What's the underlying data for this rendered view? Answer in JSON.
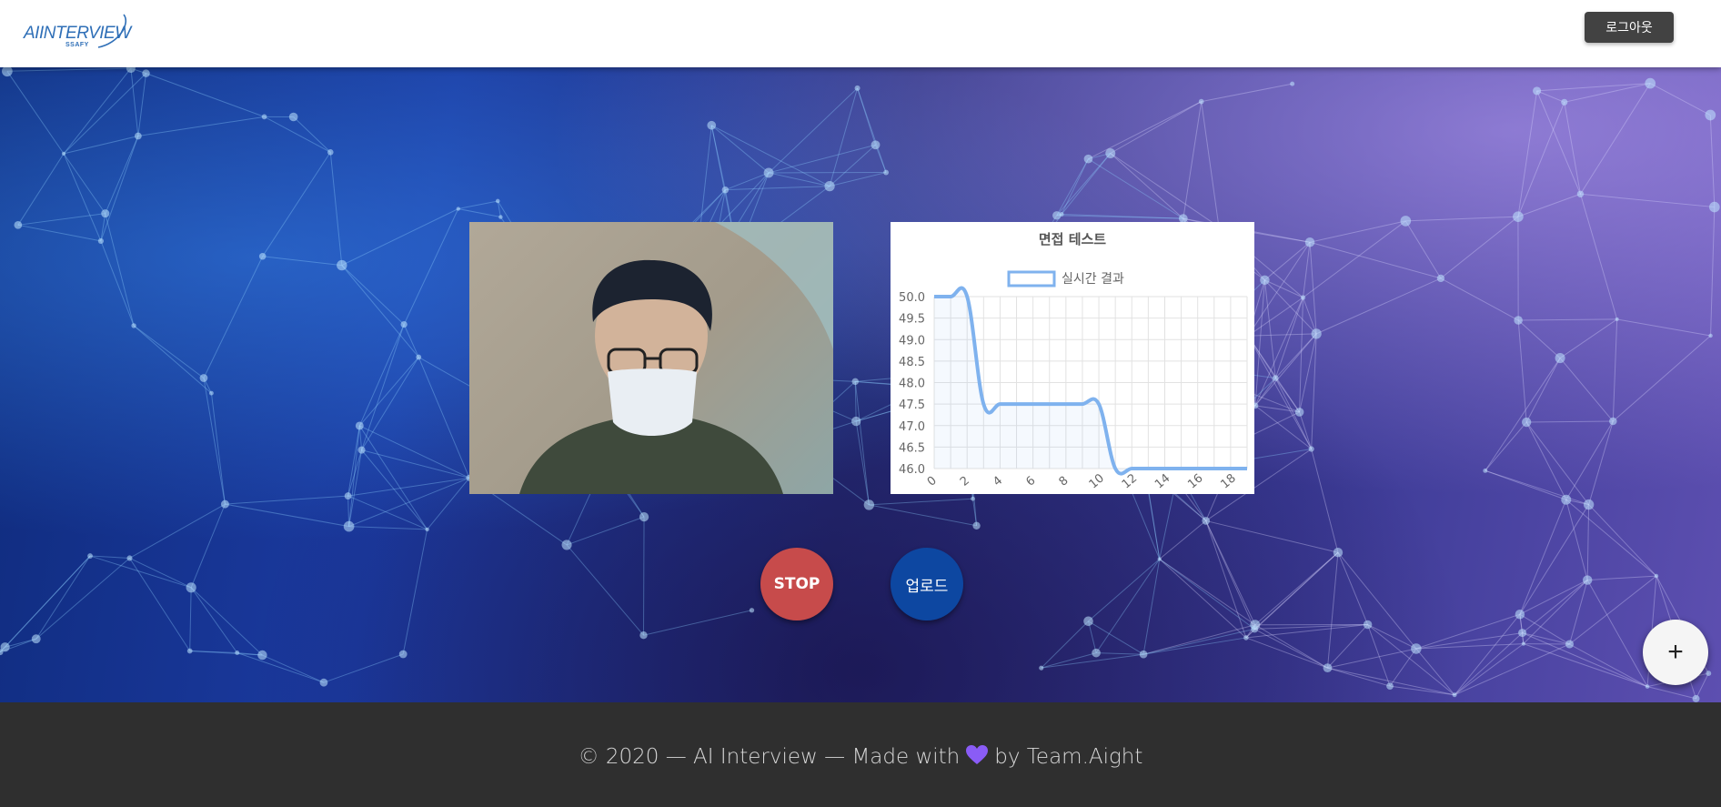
{
  "header": {
    "logo_text": "AIINTERVIEW",
    "logo_sub": "SSAFY",
    "logout_label": "로그아웃"
  },
  "icons": {
    "heart": "purple-heart-icon",
    "plus": "plus-icon"
  },
  "colors": {
    "stop": "#c74b4b",
    "upload": "#0d47a1",
    "series": "#7fb2ee",
    "heart": "#8a5cf6"
  },
  "controls": {
    "stop_label": "STOP",
    "upload_label": "업로드",
    "fab_label": "+"
  },
  "footer": {
    "copyright": "© 2020 — AI Interview — Made with",
    "by": "by Team.Aight"
  },
  "chart_data": {
    "type": "line",
    "title": "면접 테스트",
    "legend": [
      "실시간 결과"
    ],
    "legend_position": "top",
    "grid": true,
    "xlabel": "",
    "ylabel": "",
    "ylim": [
      46.0,
      50.0
    ],
    "xlim": [
      0,
      19
    ],
    "x_ticks": [
      0,
      2,
      4,
      6,
      8,
      10,
      12,
      14,
      16,
      18
    ],
    "y_ticks": [
      46.0,
      46.5,
      47.0,
      47.5,
      48.0,
      48.5,
      49.0,
      49.5,
      50.0
    ],
    "series": [
      {
        "name": "실시간 결과",
        "x": [
          0,
          1,
          2,
          3,
          4,
          5,
          6,
          7,
          8,
          9,
          10,
          11,
          12,
          13,
          14,
          15,
          16,
          17,
          18,
          19
        ],
        "values": [
          50.0,
          50.0,
          50.0,
          47.5,
          47.5,
          47.5,
          47.5,
          47.5,
          47.5,
          47.5,
          47.5,
          46.0,
          46.0,
          46.0,
          46.0,
          46.0,
          46.0,
          46.0,
          46.0,
          46.0
        ]
      }
    ]
  }
}
